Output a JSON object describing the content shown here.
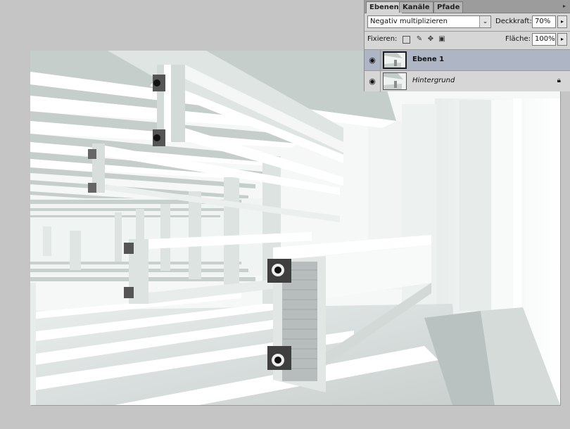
{
  "panel": {
    "tabs": [
      {
        "label": "Ebenen",
        "active": true
      },
      {
        "label": "Kanäle",
        "active": false
      },
      {
        "label": "Pfade",
        "active": false
      }
    ],
    "menu_icon": "triangle-menu-icon",
    "blend_mode": "Negativ multiplizieren",
    "opacity_label": "Deckkraft:",
    "opacity_value": "70%",
    "lock_label": "Fixieren:",
    "lock_icons": [
      "lock-transparent-icon",
      "lock-image-icon",
      "lock-position-icon",
      "lock-all-icon"
    ],
    "fill_label": "Fläche:",
    "fill_value": "100%",
    "layers": [
      {
        "name": "Ebene 1",
        "selected": true,
        "visible": true,
        "locked": false
      },
      {
        "name": "Hintergrund",
        "selected": false,
        "visible": true,
        "locked": true
      }
    ]
  },
  "colors": {
    "workspace": "#c5c5c5",
    "panel_bg": "#d6d6d6",
    "selected_layer": "#aeb6c6"
  }
}
